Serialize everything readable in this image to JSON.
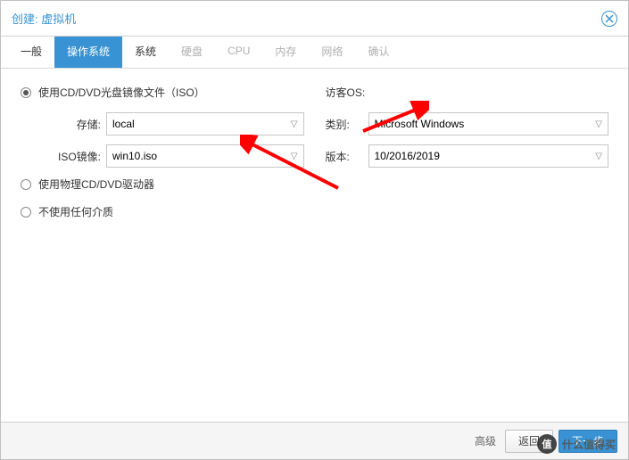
{
  "header": {
    "title": "创建: 虚拟机"
  },
  "tabs": {
    "general": "一般",
    "os": "操作系统",
    "system": "系统",
    "disk": "硬盘",
    "cpu": "CPU",
    "memory": "内存",
    "network": "网络",
    "confirm": "确认"
  },
  "left": {
    "opt_iso": "使用CD/DVD光盘镜像文件（ISO）",
    "storage_label": "存储:",
    "storage_value": "local",
    "iso_label": "ISO镜像:",
    "iso_value": "win10.iso",
    "opt_physical": "使用物理CD/DVD驱动器",
    "opt_none": "不使用任何介质"
  },
  "right": {
    "title": "访客OS:",
    "type_label": "类别:",
    "type_value": "Microsoft Windows",
    "version_label": "版本:",
    "version_value": "10/2016/2019"
  },
  "footer": {
    "advanced": "高级",
    "back": "返回",
    "next": "下一步"
  },
  "watermark": {
    "logo": "值",
    "text": "什么值得买"
  }
}
